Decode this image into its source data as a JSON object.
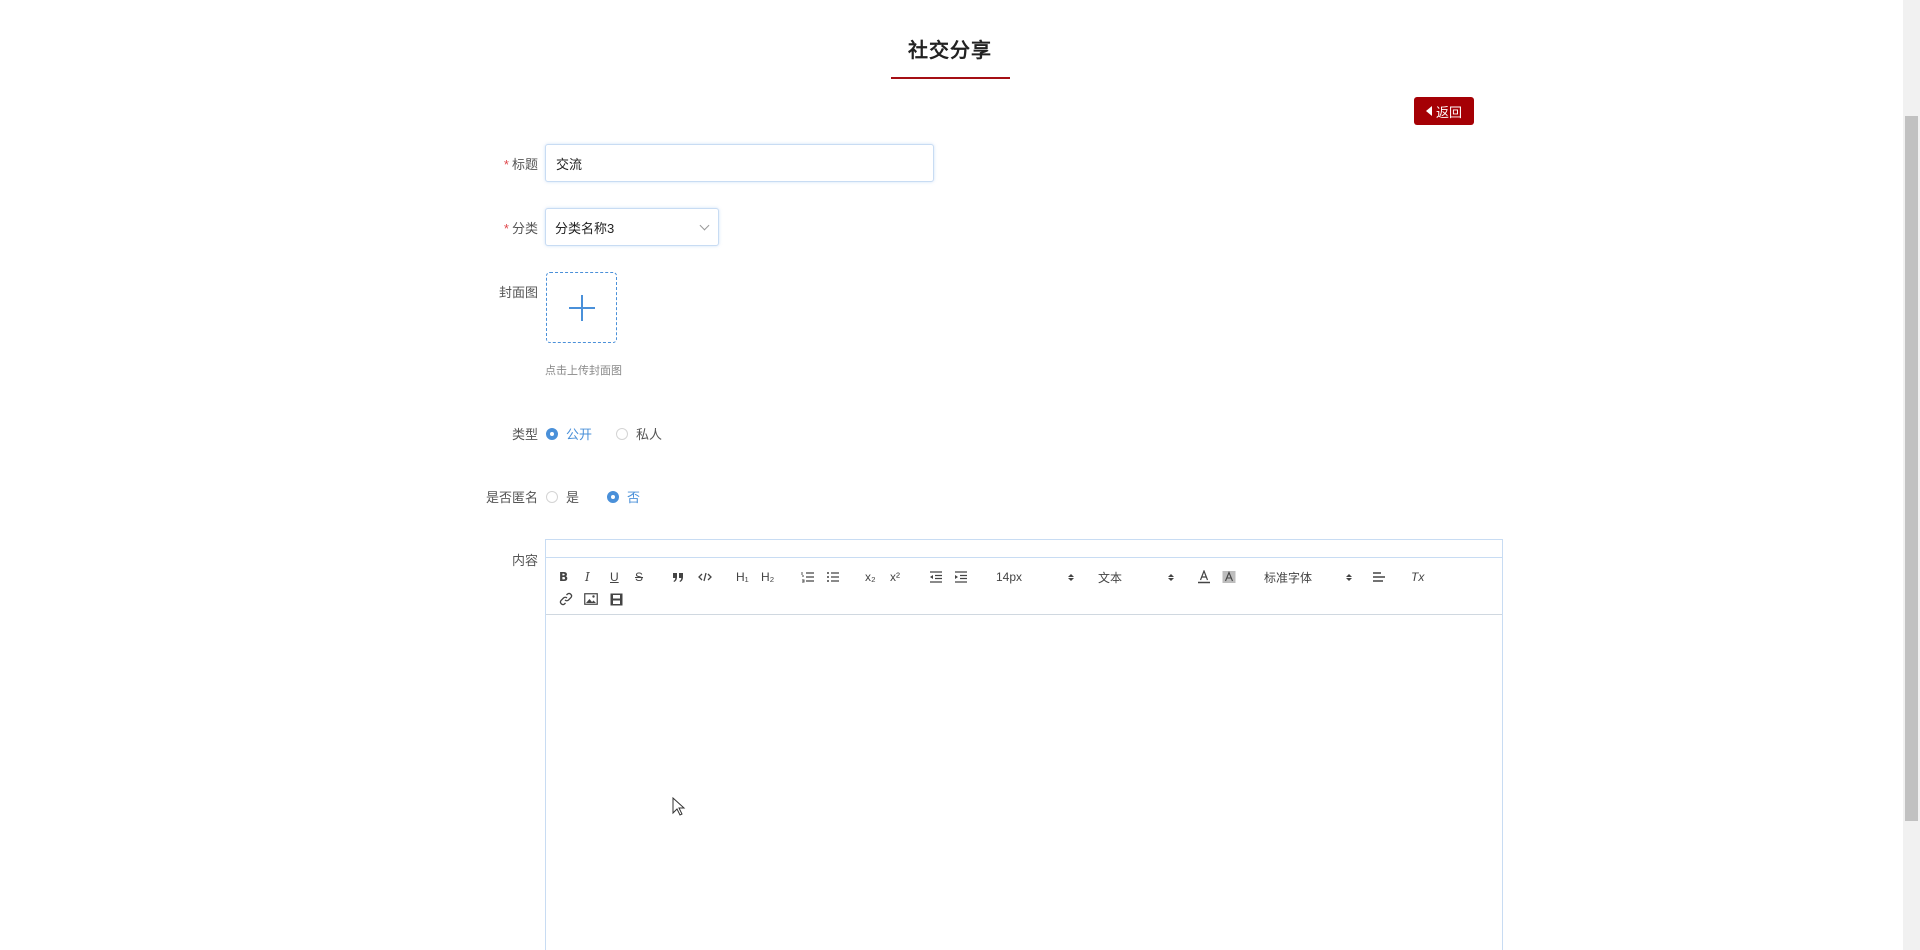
{
  "page": {
    "title": "社交分享",
    "back_label": "返回"
  },
  "form": {
    "title": {
      "label": "标题",
      "required_mark": "*",
      "value": "交流"
    },
    "category": {
      "label": "分类",
      "required_mark": "*",
      "selected": "分类名称3"
    },
    "cover": {
      "label": "封面图",
      "hint": "点击上传封面图"
    },
    "type": {
      "label": "类型",
      "options": [
        "公开",
        "私人"
      ],
      "selected": "公开"
    },
    "anonymous": {
      "label": "是否匿名",
      "options": [
        "是",
        "否"
      ],
      "selected": "否"
    },
    "content": {
      "label": "内容",
      "toolbar": {
        "bold": "B",
        "italic": "I",
        "underline": "U",
        "strike": "S",
        "header1": "H₁",
        "header2": "H₂",
        "subscript": "x₂",
        "superscript": "x²",
        "size_value": "14px",
        "text_style_value": "文本",
        "font_value": "标准字体",
        "clean": "Tx"
      },
      "value": ""
    }
  },
  "colors": {
    "accent_red": "#a50005",
    "accent_blue": "#4a90d9",
    "required": "#e0474b"
  }
}
